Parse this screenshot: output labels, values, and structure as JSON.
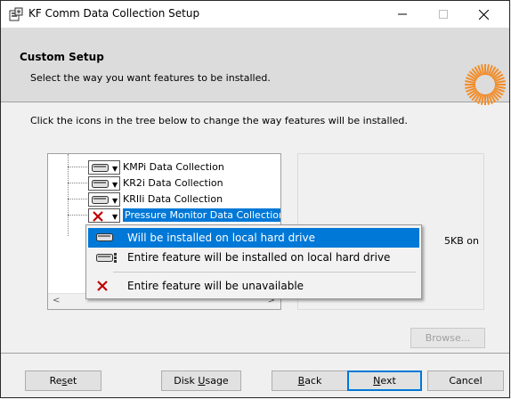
{
  "window": {
    "title": "KF Comm Data Collection Setup",
    "controls": {
      "minimize": "—",
      "maximize": "☐",
      "close": "✕"
    }
  },
  "banner": {
    "title": "Custom Setup",
    "subtitle": "Select the way you want features to be installed.",
    "logo_color": "#f28c28"
  },
  "instruction": "Click the icons in the tree below to change the way features will be installed.",
  "tree": {
    "items": [
      {
        "label": "KMPi Data Collection",
        "state_icon": "hard-drive-icon"
      },
      {
        "label": "KR2i Data Collection",
        "state_icon": "hard-drive-icon"
      },
      {
        "label": "KRIIi Data Collection",
        "state_icon": "hard-drive-icon"
      },
      {
        "label": "Pressure Monitor Data Collection",
        "state_icon": "unavailable-x-icon",
        "selected": true
      }
    ],
    "scroll_left": "<",
    "scroll_right": ">"
  },
  "description": {
    "size_text": "5KB on"
  },
  "popup_menu": {
    "items": [
      {
        "label": "Will be installed on local hard drive",
        "icon": "hard-drive-icon",
        "active": true
      },
      {
        "label": "Entire feature will be installed on local hard drive",
        "icon": "hard-drive-tree-icon",
        "active": false
      },
      {
        "label": "Entire feature will be unavailable",
        "icon": "unavailable-x-icon",
        "active": false
      }
    ]
  },
  "buttons": {
    "browse": "Browse...",
    "reset_pre": "Re",
    "reset_u": "s",
    "reset_post": "et",
    "disk_pre": "Disk ",
    "disk_u": "U",
    "disk_post": "sage",
    "back_u": "B",
    "back_post": "ack",
    "next_u": "N",
    "next_post": "ext",
    "cancel": "Cancel"
  },
  "colors": {
    "selection": "#0078d7",
    "unavailable_x": "#c00000"
  }
}
